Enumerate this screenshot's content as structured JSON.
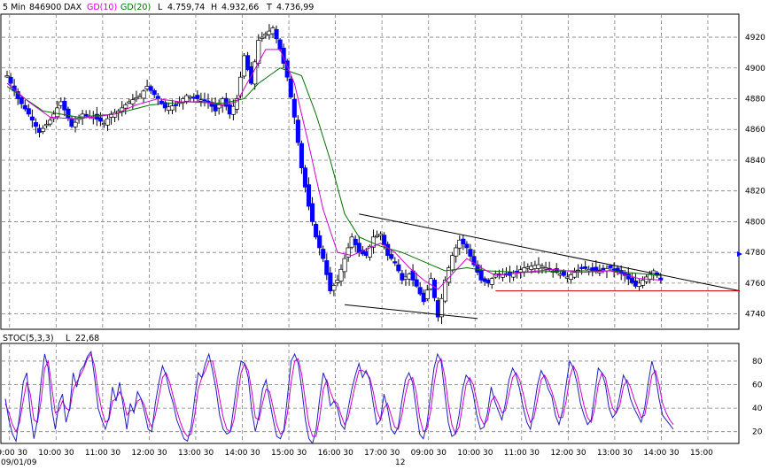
{
  "header": {
    "interval": "5 Min",
    "code": "846900",
    "symbol": "DAX",
    "gd10_label": "GD(10)",
    "gd20_label": "GD(20)",
    "low_label": "L",
    "low_value": "4.759,74",
    "high_label": "H",
    "high_value": "4.932,66",
    "close_label": "T",
    "close_value": "4.736,99"
  },
  "osc_header": {
    "name": "STOC(5,3,3)",
    "last_label": "L",
    "last_value": "22,68"
  },
  "colors": {
    "candle": "#0000ff",
    "gd10": "#d000d0",
    "gd20": "#007000",
    "resistance": "#cc0000",
    "stoch_k": "#2020c0",
    "stoch_d": "#d000d0",
    "grid": "#808080"
  },
  "chart_data": [
    {
      "type": "candlestick",
      "title": "DAX 5 Min",
      "series": [
        {
          "name": "GD(10)",
          "role": "moving average"
        },
        {
          "name": "GD(20)",
          "role": "moving average"
        }
      ],
      "ylim": [
        4730,
        4935
      ],
      "y_ticks": [
        "4740",
        "4760",
        "4780",
        "4800",
        "4820",
        "4840",
        "4860",
        "4880",
        "4900",
        "4920"
      ],
      "x_ticks": [
        "09:00 30",
        "10:00 30",
        "11:00 30",
        "12:00 30",
        "13:00 30",
        "14:00 30",
        "15:00 30",
        "16:00 30",
        "17:00 30",
        "09:00 30",
        "10:00 30",
        "11:00 30",
        "12:00 30",
        "13:00 30",
        "14:00 30",
        "15:00"
      ],
      "date_labels": [
        "09/01/09",
        "12"
      ],
      "close_path": [
        [
          0,
          4895
        ],
        [
          3,
          4880
        ],
        [
          6,
          4870
        ],
        [
          9,
          4858
        ],
        [
          12,
          4866
        ],
        [
          15,
          4878
        ],
        [
          18,
          4862
        ],
        [
          21,
          4870
        ],
        [
          24,
          4868
        ],
        [
          27,
          4864
        ],
        [
          29,
          4870
        ],
        [
          31,
          4872
        ],
        [
          34,
          4878
        ],
        [
          37,
          4882
        ],
        [
          39,
          4888
        ],
        [
          42,
          4880
        ],
        [
          44,
          4874
        ],
        [
          47,
          4876
        ],
        [
          50,
          4882
        ],
        [
          53,
          4880
        ],
        [
          56,
          4878
        ],
        [
          58,
          4872
        ],
        [
          60,
          4880
        ],
        [
          62,
          4870
        ],
        [
          64,
          4880
        ],
        [
          66,
          4908
        ],
        [
          68,
          4890
        ],
        [
          70,
          4918
        ],
        [
          72,
          4922
        ],
        [
          74,
          4926
        ],
        [
          76,
          4912
        ],
        [
          78,
          4894
        ],
        [
          80,
          4868
        ],
        [
          82,
          4835
        ],
        [
          84,
          4810
        ],
        [
          86,
          4790
        ],
        [
          88,
          4776
        ],
        [
          90,
          4755
        ],
        [
          92,
          4762
        ],
        [
          94,
          4776
        ],
        [
          96,
          4790
        ],
        [
          98,
          4780
        ],
        [
          100,
          4778
        ],
        [
          102,
          4790
        ],
        [
          104,
          4792
        ],
        [
          106,
          4778
        ],
        [
          108,
          4774
        ],
        [
          110,
          4762
        ],
        [
          112,
          4766
        ],
        [
          114,
          4758
        ],
        [
          116,
          4748
        ],
        [
          118,
          4763
        ],
        [
          120,
          4738
        ],
        [
          122,
          4762
        ],
        [
          124,
          4778
        ],
        [
          126,
          4788
        ],
        [
          128,
          4783
        ],
        [
          130,
          4772
        ],
        [
          132,
          4762
        ],
        [
          134,
          4760
        ],
        [
          136,
          4766
        ],
        [
          140,
          4765
        ],
        [
          144,
          4770
        ],
        [
          148,
          4772
        ],
        [
          152,
          4768
        ],
        [
          156,
          4764
        ],
        [
          160,
          4770
        ],
        [
          164,
          4768
        ],
        [
          168,
          4770
        ],
        [
          172,
          4765
        ],
        [
          175,
          4758
        ],
        [
          177,
          4762
        ],
        [
          180,
          4768
        ],
        [
          182,
          4762
        ]
      ],
      "gd10_path": [
        [
          0,
          4890
        ],
        [
          6,
          4878
        ],
        [
          12,
          4868
        ],
        [
          18,
          4867
        ],
        [
          24,
          4868
        ],
        [
          30,
          4870
        ],
        [
          36,
          4876
        ],
        [
          42,
          4880
        ],
        [
          48,
          4878
        ],
        [
          54,
          4878
        ],
        [
          60,
          4876
        ],
        [
          64,
          4878
        ],
        [
          68,
          4895
        ],
        [
          72,
          4912
        ],
        [
          76,
          4912
        ],
        [
          80,
          4890
        ],
        [
          84,
          4850
        ],
        [
          88,
          4808
        ],
        [
          92,
          4780
        ],
        [
          96,
          4778
        ],
        [
          100,
          4782
        ],
        [
          104,
          4786
        ],
        [
          108,
          4780
        ],
        [
          112,
          4770
        ],
        [
          116,
          4762
        ],
        [
          120,
          4756
        ],
        [
          124,
          4766
        ],
        [
          128,
          4776
        ],
        [
          132,
          4770
        ],
        [
          136,
          4765
        ],
        [
          144,
          4767
        ],
        [
          152,
          4769
        ],
        [
          160,
          4767
        ],
        [
          168,
          4768
        ],
        [
          176,
          4763
        ],
        [
          182,
          4762
        ]
      ],
      "gd20_path": [
        [
          0,
          4888
        ],
        [
          10,
          4872
        ],
        [
          20,
          4868
        ],
        [
          30,
          4870
        ],
        [
          40,
          4876
        ],
        [
          50,
          4878
        ],
        [
          60,
          4877
        ],
        [
          66,
          4880
        ],
        [
          70,
          4890
        ],
        [
          76,
          4900
        ],
        [
          82,
          4895
        ],
        [
          86,
          4870
        ],
        [
          90,
          4840
        ],
        [
          94,
          4805
        ],
        [
          98,
          4790
        ],
        [
          104,
          4784
        ],
        [
          110,
          4780
        ],
        [
          116,
          4774
        ],
        [
          122,
          4768
        ],
        [
          128,
          4770
        ],
        [
          134,
          4768
        ],
        [
          144,
          4767
        ],
        [
          156,
          4768
        ],
        [
          168,
          4768
        ],
        [
          182,
          4765
        ]
      ],
      "trendlines": [
        {
          "from": [
            98,
            4805
          ],
          "to": [
            204,
            4755
          ]
        },
        {
          "from": [
            94,
            4746
          ],
          "to": [
            131,
            4737
          ]
        },
        {
          "from": [
            136,
            4755
          ],
          "to": [
            204,
            4755
          ],
          "color": "red"
        }
      ]
    },
    {
      "type": "line",
      "title": "STOC(5,3,3)",
      "ylim": [
        10,
        95
      ],
      "y_ticks": [
        "20",
        "40",
        "60",
        "80"
      ],
      "last_value": 22.68,
      "k_values": [
        48,
        30,
        18,
        12,
        34,
        62,
        70,
        36,
        14,
        30,
        62,
        86,
        74,
        40,
        22,
        44,
        52,
        28,
        40,
        70,
        58,
        72,
        76,
        84,
        88,
        66,
        40,
        30,
        22,
        32,
        58,
        46,
        62,
        42,
        22,
        44,
        36,
        54,
        48,
        36,
        22,
        20,
        44,
        62,
        76,
        68,
        54,
        44,
        30,
        22,
        14,
        12,
        24,
        48,
        70,
        66,
        78,
        86,
        72,
        56,
        34,
        22,
        18,
        20,
        42,
        64,
        80,
        78,
        66,
        38,
        20,
        34,
        56,
        64,
        46,
        30,
        16,
        14,
        22,
        50,
        80,
        86,
        78,
        56,
        30,
        14,
        10,
        22,
        48,
        70,
        62,
        42,
        46,
        40,
        26,
        22,
        40,
        56,
        68,
        78,
        66,
        72,
        64,
        44,
        26,
        30,
        52,
        40,
        22,
        18,
        24,
        46,
        64,
        70,
        62,
        40,
        18,
        14,
        26,
        50,
        74,
        86,
        80,
        54,
        28,
        16,
        18,
        34,
        56,
        68,
        64,
        52,
        34,
        22,
        24,
        36,
        58,
        46,
        38,
        30,
        44,
        64,
        74,
        68,
        56,
        40,
        28,
        22,
        40,
        60,
        72,
        66,
        56,
        50,
        34,
        26,
        38,
        60,
        80,
        74,
        62,
        44,
        34,
        26,
        30,
        52,
        74,
        70,
        60,
        40,
        32,
        36,
        50,
        68,
        62,
        48,
        40,
        34,
        28,
        40,
        62,
        80,
        68,
        48,
        34,
        30,
        26,
        22
      ],
      "d_values": [
        44,
        36,
        26,
        20,
        28,
        46,
        62,
        52,
        30,
        28,
        46,
        74,
        80,
        58,
        36,
        38,
        46,
        40,
        38,
        56,
        62,
        68,
        74,
        82,
        86,
        76,
        54,
        38,
        28,
        30,
        46,
        48,
        54,
        48,
        34,
        38,
        38,
        46,
        48,
        42,
        30,
        24,
        34,
        50,
        66,
        70,
        62,
        50,
        38,
        28,
        20,
        16,
        18,
        34,
        56,
        66,
        72,
        80,
        80,
        66,
        48,
        32,
        22,
        20,
        30,
        50,
        70,
        78,
        72,
        54,
        32,
        30,
        44,
        56,
        54,
        40,
        26,
        18,
        20,
        36,
        62,
        80,
        82,
        68,
        46,
        26,
        16,
        16,
        32,
        56,
        64,
        54,
        46,
        44,
        34,
        26,
        32,
        46,
        60,
        72,
        72,
        70,
        66,
        54,
        38,
        30,
        40,
        44,
        34,
        24,
        22,
        34,
        52,
        64,
        66,
        54,
        32,
        20,
        22,
        36,
        60,
        78,
        82,
        68,
        44,
        26,
        18,
        24,
        42,
        60,
        66,
        60,
        46,
        32,
        26,
        30,
        46,
        50,
        44,
        36,
        38,
        52,
        66,
        70,
        64,
        52,
        38,
        28,
        32,
        48,
        64,
        68,
        62,
        54,
        44,
        32,
        32,
        46,
        66,
        76,
        70,
        56,
        42,
        32,
        28,
        40,
        60,
        70,
        66,
        52,
        40,
        36,
        42,
        58,
        64,
        58,
        48,
        40,
        32,
        34,
        50,
        68,
        72,
        60,
        44,
        36,
        30,
        26
      ]
    }
  ]
}
